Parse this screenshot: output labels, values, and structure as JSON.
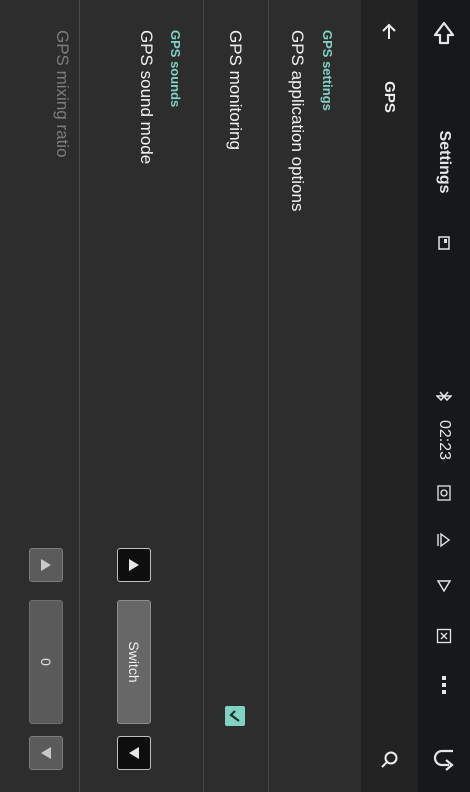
{
  "statusbar": {
    "title": "Settings",
    "time": "02:23",
    "icons": [
      "back-arrow-icon",
      "screen-icon",
      "bluetooth-icon",
      "radio-icon",
      "eject-icon",
      "play-icon",
      "sim-card-icon",
      "more-icon",
      "undo-icon"
    ]
  },
  "appbar": {
    "back_icon": "arrow-back-icon",
    "title": "GPS",
    "search_icon": "search-icon"
  },
  "sections": {
    "gps_settings_header": "GPS settings",
    "gps_application_options": "GPS application options",
    "gps_monitoring": "GPS monitoring",
    "gps_monitoring_checked": true,
    "gps_sounds_header": "GPS sounds",
    "gps_sound_mode": "GPS sound mode",
    "gps_sound_mode_value": "Switch",
    "gps_mixing_ratio": "GPS mixing ratio",
    "gps_mixing_ratio_value": "0"
  },
  "colors": {
    "accent": "#7fd3c3",
    "statusbar_bg": "#16181b",
    "appbar_bg": "#232323",
    "content_bg": "#2d2d2d"
  }
}
